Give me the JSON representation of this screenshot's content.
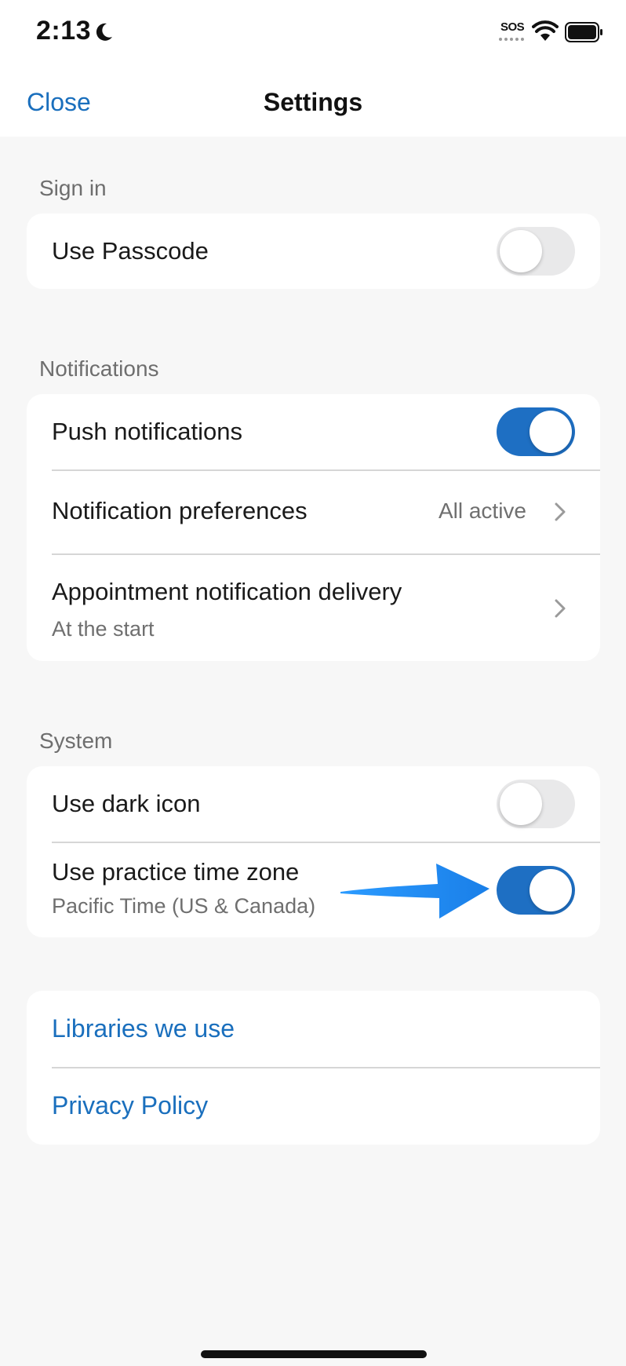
{
  "status_bar": {
    "time": "2:13",
    "sos": "SOS"
  },
  "nav": {
    "close_label": "Close",
    "title": "Settings"
  },
  "sections": {
    "sign_in": {
      "header": "Sign in",
      "use_passcode": {
        "label": "Use Passcode",
        "enabled": false
      }
    },
    "notifications": {
      "header": "Notifications",
      "push": {
        "label": "Push notifications",
        "enabled": true
      },
      "preferences": {
        "label": "Notification preferences",
        "value": "All active"
      },
      "appointment_delivery": {
        "label": "Appointment notification delivery",
        "value": "At the start"
      }
    },
    "system": {
      "header": "System",
      "dark_icon": {
        "label": "Use dark icon",
        "enabled": false
      },
      "practice_time_zone": {
        "label": "Use practice time zone",
        "value": "Pacific Time (US & Canada)",
        "enabled": true
      }
    },
    "links": {
      "libraries": "Libraries we use",
      "privacy": "Privacy Policy"
    }
  },
  "colors": {
    "accent": "#1a6fbd",
    "toggle_on": "#1e6fc3",
    "toggle_off": "#e9e9ea",
    "annotation_arrow": "#1e90ff",
    "background": "#f7f7f7"
  }
}
